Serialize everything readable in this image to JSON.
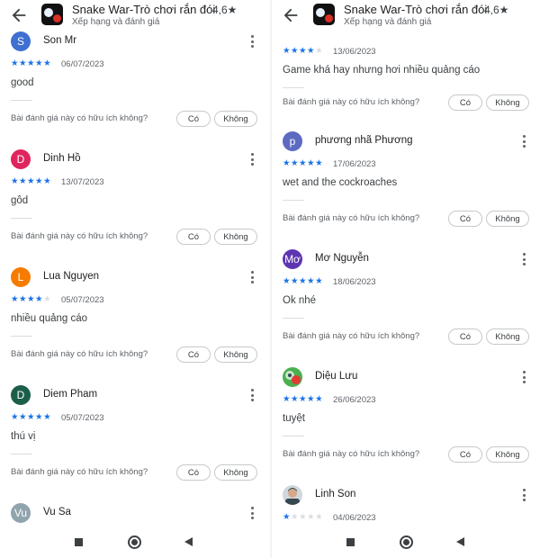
{
  "app": {
    "title": "Snake War-Trò chơi rắn đói",
    "rating": "4,6★",
    "subtitle": "Xếp hạng và đánh giá"
  },
  "helpful_question": "Bài đánh giá này có hữu ích không?",
  "yes_label": "Có",
  "no_label": "Không",
  "left": {
    "reviews": [
      {
        "initial": "S",
        "name": "Son Mr",
        "color": "#3f6fd1",
        "stars": 5,
        "date": "06/07/2023",
        "text": "good"
      },
      {
        "initial": "D",
        "name": "Dinh Hồ",
        "color": "#e0245e",
        "stars": 5,
        "date": "13/07/2023",
        "text": "gôd"
      },
      {
        "initial": "L",
        "name": "Lua Nguyen",
        "color": "#f57c00",
        "stars": 4,
        "date": "05/07/2023",
        "text": "nhiều quảng cáo"
      },
      {
        "initial": "D",
        "name": "Diem Pham",
        "color": "#1b5e4a",
        "stars": 5,
        "date": "05/07/2023",
        "text": "thú vị"
      },
      {
        "initial": "Vu",
        "name": "Vu Sa",
        "color": "#90a4ae"
      }
    ]
  },
  "right": {
    "partial": {
      "stars": 4,
      "date": "13/06/2023",
      "text": "Game khá hay nhưng hơi nhiều quảng cáo"
    },
    "reviews": [
      {
        "initial": "p",
        "name": "phương nhã Phương",
        "color": "#5c6bc0",
        "stars": 5,
        "date": "17/06/2023",
        "text": "wet and the cockroaches"
      },
      {
        "initial": "Mơ",
        "name": "Mơ Nguyễn",
        "color": "#5e35b1",
        "stars": 5,
        "date": "18/06/2023",
        "text": "Ok nhé"
      },
      {
        "photo": "green",
        "name": "Diệu Lưu",
        "stars": 5,
        "date": "26/06/2023",
        "text": "tuyệt"
      },
      {
        "photo": "face",
        "name": "Linh Son",
        "stars": 1,
        "date": "04/06/2023"
      }
    ]
  }
}
